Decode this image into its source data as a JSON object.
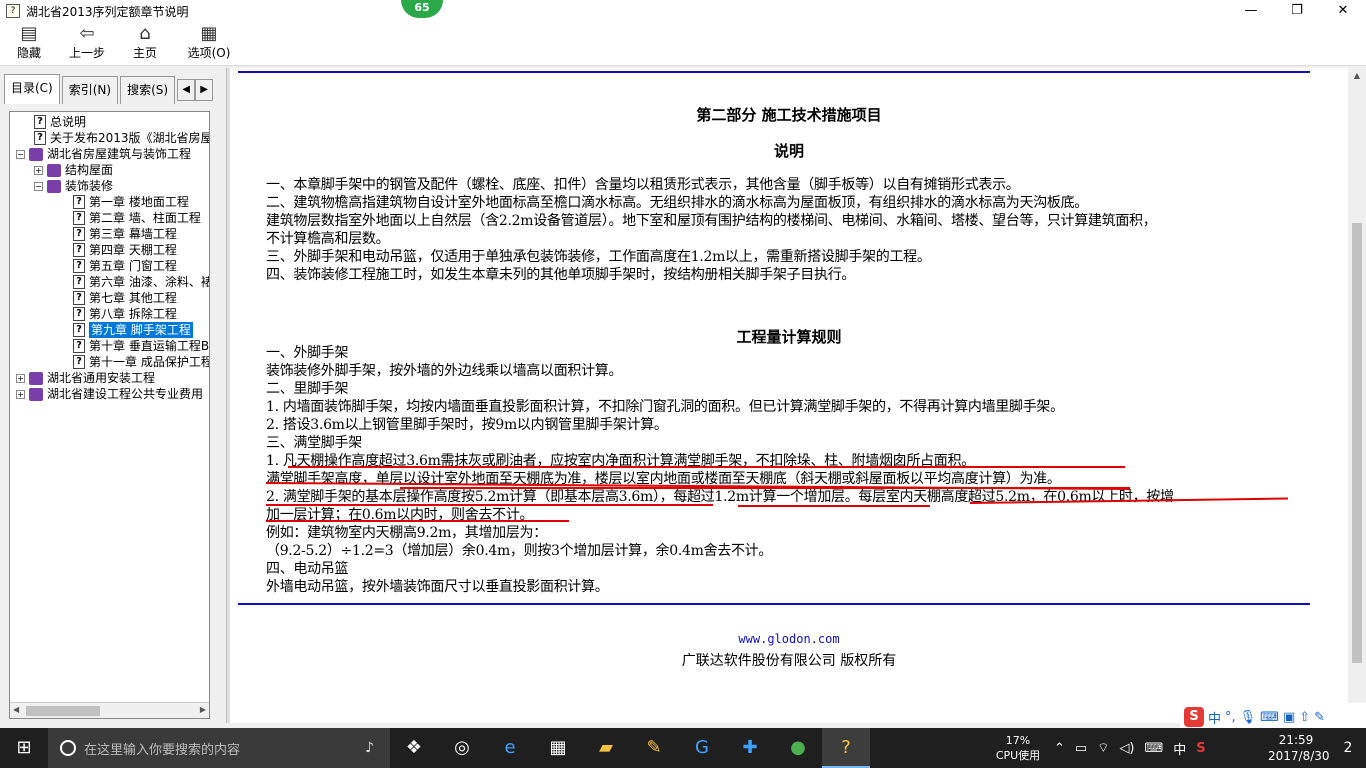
{
  "window": {
    "title": "湖北省2013序列定额章节说明",
    "badge": "65",
    "minimize": "—",
    "maximize": "❐",
    "close": "✕"
  },
  "toolbar": [
    {
      "label": "隐藏",
      "icon": "hide-icon"
    },
    {
      "label": "上一步",
      "icon": "back-arrow-icon"
    },
    {
      "label": "主页",
      "icon": "home-icon"
    },
    {
      "label": "选项(O)",
      "icon": "options-icon"
    }
  ],
  "tabs": [
    "目录(C)",
    "索引(N)",
    "搜索(S)"
  ],
  "tree": [
    {
      "label": "总说明",
      "type": "doc",
      "level": 1
    },
    {
      "label": "关于发布2013版《湖北省房屋",
      "type": "doc",
      "level": 1
    },
    {
      "label": "湖北省房屋建筑与装饰工程",
      "type": "book",
      "level": 0,
      "exp": "⊟"
    },
    {
      "label": "结构屋面",
      "type": "book",
      "level": 1,
      "exp": "⊞"
    },
    {
      "label": "装饰装修",
      "type": "book",
      "level": 1,
      "exp": "⊟"
    },
    {
      "label": "第一章 楼地面工程",
      "type": "doc",
      "level": 3
    },
    {
      "label": "第二章 墙、柱面工程",
      "type": "doc",
      "level": 3
    },
    {
      "label": "第三章 幕墙工程",
      "type": "doc",
      "level": 3
    },
    {
      "label": "第四章 天棚工程",
      "type": "doc",
      "level": 3
    },
    {
      "label": "第五章 门窗工程",
      "type": "doc",
      "level": 3
    },
    {
      "label": "第六章 油漆、涂料、裱",
      "type": "doc",
      "level": 3
    },
    {
      "label": "第七章 其他工程",
      "type": "doc",
      "level": 3
    },
    {
      "label": "第八章 拆除工程",
      "type": "doc",
      "level": 3
    },
    {
      "label": "第九章 脚手架工程",
      "type": "doc",
      "level": 3,
      "selected": true
    },
    {
      "label": "第十章 垂直运输工程B",
      "type": "doc",
      "level": 3
    },
    {
      "label": "第十一章 成品保护工程",
      "type": "doc",
      "level": 3
    },
    {
      "label": "湖北省通用安装工程",
      "type": "book",
      "level": 0,
      "exp": "⊞"
    },
    {
      "label": "湖北省建设工程公共专业费用",
      "type": "book",
      "level": 0,
      "exp": "⊞"
    }
  ],
  "content": {
    "part_title": "第二部分 施工技术措施项目",
    "section1_title": "说明",
    "section1": [
      "一、本章脚手架中的钢管及配件（螺栓、底座、扣件）含量均以租赁形式表示，其他含量（脚手板等）以自有摊销形式表示。",
      "二、建筑物檐高指建筑物自设计室外地面标高至檐口滴水标高。无组织排水的滴水标高为屋面板顶，有组织排水的滴水标高为天沟板底。",
      "建筑物层数指室外地面以上自然层（含2.2m设备管道层）。地下室和屋顶有围护结构的楼梯间、电梯间、水箱间、塔楼、望台等，只计算建筑面积，",
      "不计算檐高和层数。",
      "三、外脚手架和电动吊篮，仅适用于单独承包装饰装修，工作面高度在1.2m以上，需重新搭设脚手架的工程。",
      "四、装饰装修工程施工时，如发生本章未列的其他单项脚手架时，按结构册相关脚手架子目执行。"
    ],
    "section2_title": "工程量计算规则",
    "section2": [
      "一、外脚手架",
      "装饰装修外脚手架，按外墙的外边线乘以墙高以面积计算。",
      "二、里脚手架",
      "1. 内墙面装饰脚手架，均按内墙面垂直投影面积计算，不扣除门窗孔洞的面积。但已计算满堂脚手架的，不得再计算内墙里脚手架。",
      "2. 搭设3.6m以上钢管里脚手架时，按9m以内钢管里脚手架计算。",
      "三、满堂脚手架",
      "1. 凡天棚操作高度超过3.6m需抹灰或刷油者，应按室内净面积计算满堂脚手架，不扣除垛、柱、附墙烟囱所占面积。",
      "满堂脚手架高度，单层以设计室外地面至天棚底为准，楼层以室内地面或楼面至天棚底（斜天棚或斜屋面板以平均高度计算）为准。",
      "2. 满堂脚手架的基本层操作高度按5.2m计算（即基本层高3.6m），每超过1.2m计算一个增加层。每层室内天棚高度超过5.2m，在0.6m以上时，按增",
      "加一层计算；在0.6m以内时，则舍去不计。",
      "例如：建筑物室内天棚高9.2m，其增加层为：",
      "（9.2-5.2）÷1.2=3（增加层）余0.4m，则按3个增加层计算，余0.4m舍去不计。",
      "四、电动吊篮",
      "外墙电动吊篮，按外墙装饰面尺寸以垂直投影面积计算。"
    ],
    "footer_link": "www.glodon.com",
    "footer_copy": "广联达软件股份有限公司 版权所有"
  },
  "ime": {
    "logo": "S",
    "mode": "中",
    "punct": "°,"
  },
  "taskbar": {
    "search_placeholder": "在这里输入你要搜索的内容",
    "apps": [
      "task-view-icon",
      "swirl-app-icon",
      "edge-icon",
      "store-icon",
      "file-explorer-icon",
      "notepad-app-icon",
      "glodon-g-icon",
      "plus-app-icon",
      "green-app-icon",
      "help-app-icon"
    ],
    "cpu_percent": "17%",
    "cpu_label": "CPU使用",
    "ime_lang": "中",
    "time": "21:59",
    "date": "2017/8/30",
    "notifications": "2"
  }
}
